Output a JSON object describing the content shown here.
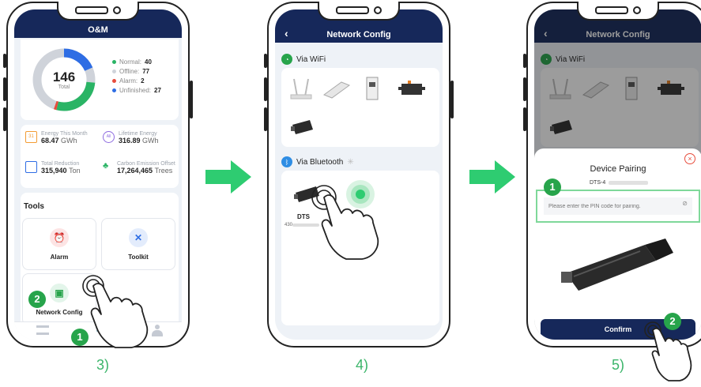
{
  "screen3": {
    "title": "O&M",
    "donut": {
      "total": "146",
      "total_label": "Total"
    },
    "legend": [
      {
        "label": "Normal:",
        "value": "40",
        "color": "#2ab465"
      },
      {
        "label": "Offline:",
        "value": "77",
        "color": "#cfd3da"
      },
      {
        "label": "Alarm:",
        "value": "2",
        "color": "#e74c3c"
      },
      {
        "label": "Unfinished:",
        "value": "27",
        "color": "#2e6de4"
      }
    ],
    "stats": [
      {
        "label": "Energy This Month",
        "value": "68.47",
        "unit": "GWh"
      },
      {
        "label": "Lifetime Energy",
        "value": "316.89",
        "unit": "GWh"
      },
      {
        "label": "Total Reduction",
        "value": "315,940",
        "unit": "Ton"
      },
      {
        "label": "Carbon Emission Offset",
        "value": "17,264,465",
        "unit": "Trees"
      }
    ],
    "tools_title": "Tools",
    "tools": {
      "alarm": "Alarm",
      "toolkit": "Toolkit",
      "network": "Network Config"
    },
    "badge1": "1",
    "badge2": "2",
    "caption": "3)"
  },
  "screen4": {
    "title": "Network Config",
    "wifi_label": "Via WiFi",
    "bt_label": "Via Bluetooth",
    "device_name": "DTS",
    "device_sn": "430",
    "caption": "4)"
  },
  "screen5": {
    "title": "Network Config",
    "wifi_label": "Via WiFi",
    "dialog_title": "Device Pairing",
    "device_id": "DTS-4",
    "pin_placeholder": "Please enter the PIN code for pairing.",
    "confirm": "Confirm",
    "badge1": "1",
    "badge2": "2",
    "caption": "5)"
  },
  "colors": {
    "navy": "#16285a",
    "green": "#27a44b",
    "accent": "#3bb56a"
  }
}
